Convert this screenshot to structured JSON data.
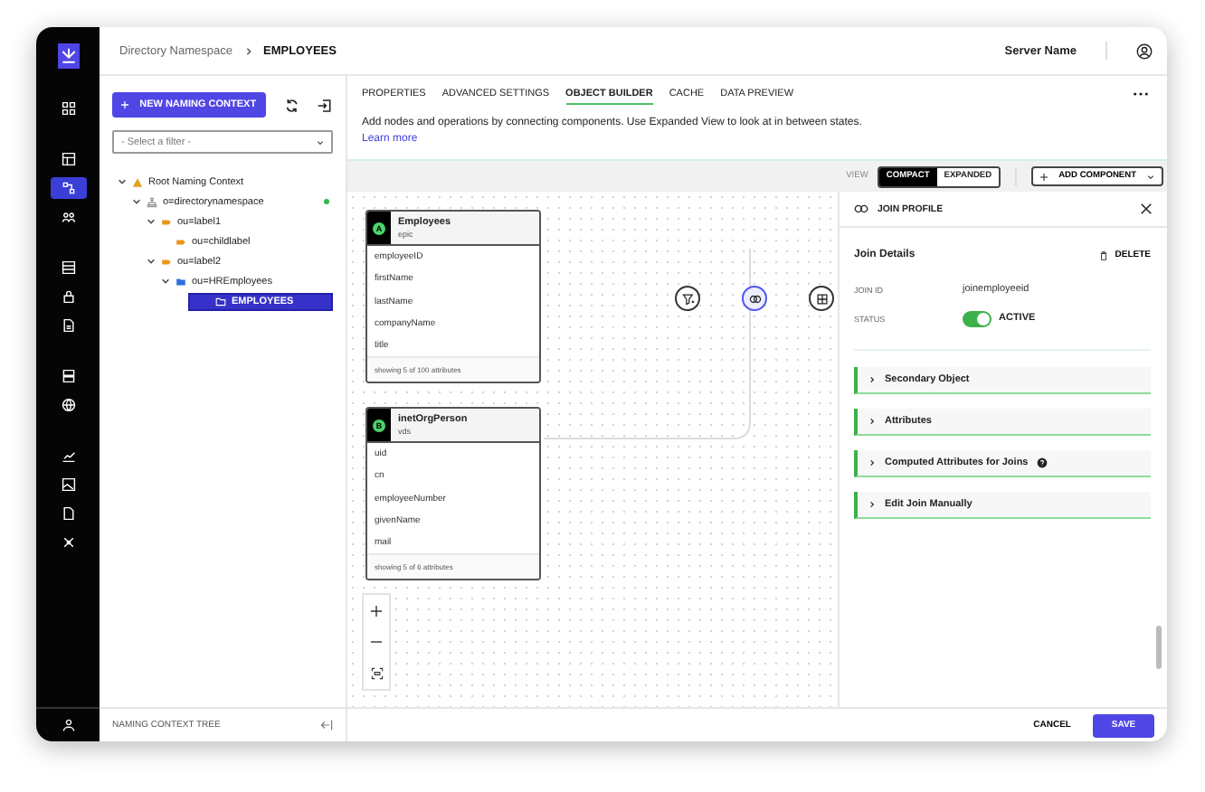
{
  "rail": {
    "groups": [
      {
        "items": [
          {
            "selected": false
          }
        ]
      },
      {
        "items": [
          {
            "selected": false
          },
          {
            "selected": true
          },
          {
            "selected": false
          }
        ]
      },
      {
        "items": [
          {
            "selected": false
          },
          {
            "selected": false
          },
          {
            "selected": false
          }
        ]
      },
      {
        "items": [
          {
            "selected": false
          },
          {
            "selected": false
          }
        ]
      },
      {
        "items": [
          {
            "selected": false
          },
          {
            "selected": false
          },
          {
            "selected": false
          },
          {
            "selected": false
          }
        ]
      }
    ],
    "bottom": {
      "selected": false
    }
  },
  "breadcrumb": [
    "Directory Namespace",
    "EMPLOYEES"
  ],
  "server_name": "Server Name",
  "left_panel": {
    "new_button": "NEW NAMING CONTEXT",
    "filter": {
      "placeholder": "- Select a filter -"
    },
    "tree": [
      {
        "label": "Root Naming Context",
        "kind": "root",
        "expanded": true,
        "selected": false,
        "online": false,
        "children": [
          {
            "label": "o=directorynamespace",
            "kind": "org",
            "expanded": true,
            "selected": false,
            "online": true,
            "children": [
              {
                "label": "ou=label1",
                "kind": "label",
                "expanded": true,
                "selected": false,
                "online": false,
                "children": [
                  {
                    "label": "ou=childlabel",
                    "kind": "label",
                    "selected": false,
                    "online": false
                  }
                ]
              },
              {
                "label": "ou=label2",
                "kind": "label",
                "expanded": true,
                "selected": false,
                "online": false,
                "children": [
                  {
                    "label": "ou=HREmployees",
                    "kind": "folder",
                    "expanded": true,
                    "selected": false,
                    "online": false,
                    "children": [
                      {
                        "label": "EMPLOYEES",
                        "kind": "object",
                        "selected": true,
                        "online": false
                      }
                    ]
                  }
                ]
              }
            ]
          }
        ]
      }
    ],
    "footer": "NAMING CONTEXT TREE"
  },
  "tabs": [
    {
      "label": "PROPERTIES",
      "selected": false
    },
    {
      "label": "ADVANCED SETTINGS",
      "selected": false
    },
    {
      "label": "OBJECT BUILDER",
      "selected": true
    },
    {
      "label": "CACHE",
      "selected": false
    },
    {
      "label": "DATA PREVIEW",
      "selected": false
    }
  ],
  "description": "Add nodes and operations by connecting components. Use Expanded View to look at in between states.",
  "learn_more": "Learn more",
  "toolbar": {
    "view_label": "VIEW",
    "view_options": [
      {
        "label": "COMPACT",
        "selected": true
      },
      {
        "label": "EXPANDED",
        "selected": false
      }
    ],
    "add_component": "ADD COMPONENT"
  },
  "canvas": {
    "objects": [
      {
        "badge": "A",
        "name": "Employees",
        "source": "epic",
        "attributes": [
          "employeeID",
          "firstName",
          "lastName",
          "companyName",
          "title"
        ],
        "footer": "showing 5 of 100 attributes"
      },
      {
        "badge": "B",
        "name": "inetOrgPerson",
        "source": "vds",
        "attributes": [
          "uid",
          "cn",
          "employeeNumber",
          "givenName",
          "mail"
        ],
        "footer": "showing 5 of 6 attributes"
      }
    ],
    "operations": [
      {
        "kind": "filter",
        "selected": false
      },
      {
        "kind": "join",
        "selected": true
      },
      {
        "kind": "table",
        "selected": false
      }
    ]
  },
  "join_profile": {
    "title": "JOIN PROFILE",
    "details_title": "Join Details",
    "delete": "DELETE",
    "fields": [
      {
        "label": "JOIN ID",
        "value": "joinemployeeid"
      }
    ],
    "status": {
      "label": "STATUS",
      "on": true,
      "value": "ACTIVE"
    },
    "sections": [
      {
        "title": "Secondary Object",
        "expanded": false,
        "help": false
      },
      {
        "title": "Attributes",
        "expanded": false,
        "help": false
      },
      {
        "title": "Computed Attributes for Joins",
        "expanded": false,
        "help": true
      },
      {
        "title": "Edit Join Manually",
        "expanded": false,
        "help": false
      }
    ]
  },
  "footer": {
    "cancel": "CANCEL",
    "save": "SAVE"
  }
}
